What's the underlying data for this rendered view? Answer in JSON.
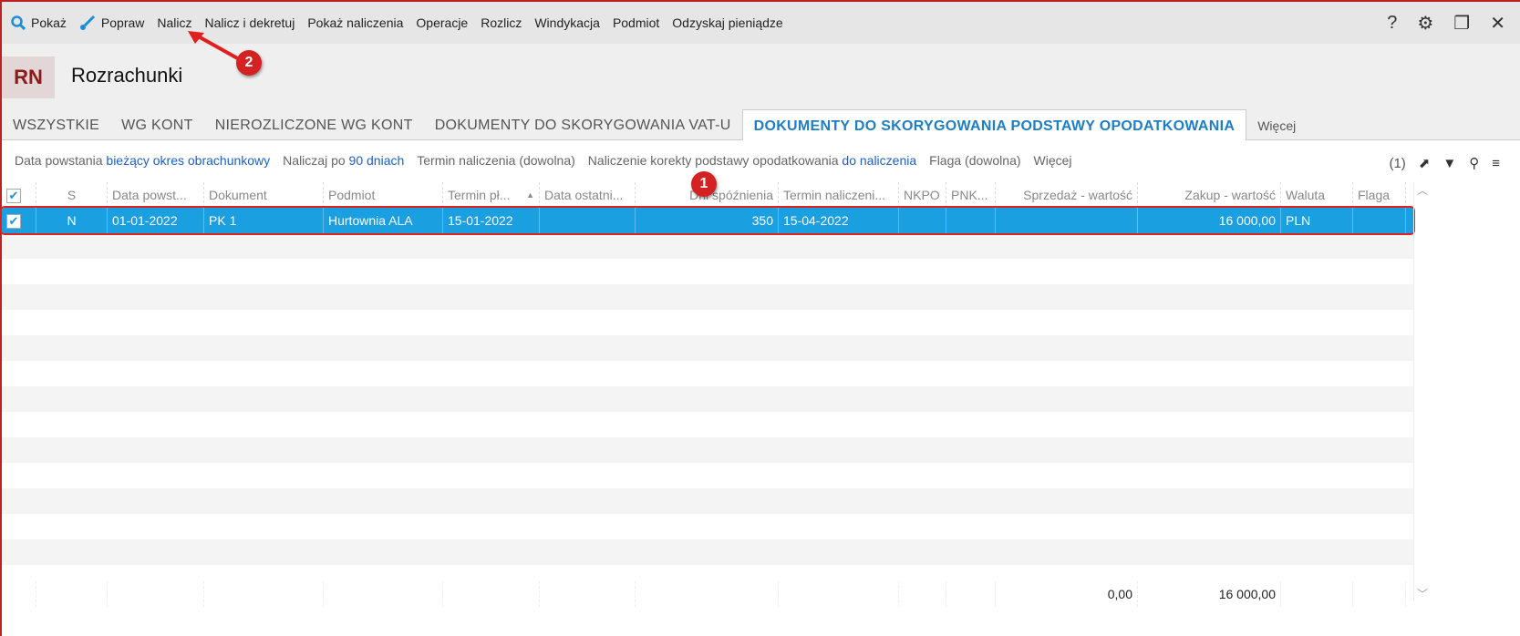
{
  "toolbar": {
    "items": [
      "Pokaż",
      "Popraw",
      "Nalicz",
      "Nalicz i dekretuj",
      "Pokaż naliczenia",
      "Operacje",
      "Rozlicz",
      "Windykacja",
      "Podmiot",
      "Odzyskaj pieniądze"
    ],
    "help": "?"
  },
  "header": {
    "badge": "RN",
    "title": "Rozrachunki"
  },
  "tabs": [
    "WSZYSTKIE",
    "WG KONT",
    "NIEROZLICZONE WG KONT",
    "DOKUMENTY DO SKORYGOWANIA VAT-U",
    "DOKUMENTY DO SKORYGOWANIA PODSTAWY OPODATKOWANIA",
    "Więcej"
  ],
  "active_tab": 4,
  "filters": {
    "f1_label": "Data powstania",
    "f1_value": "bieżący okres obrachunkowy",
    "f2_label": "Naliczaj po",
    "f2_value": "90 dniach",
    "f3": "Termin naliczenia (dowolna)",
    "f4_label": "Naliczenie korekty podstawy opodatkowania",
    "f4_value": "do naliczenia",
    "f5": "Flaga (dowolna)",
    "f6": "Więcej",
    "count": "(1)"
  },
  "grid": {
    "columns": [
      "",
      "S",
      "Data powst...",
      "Dokument",
      "Podmiot",
      "Termin pł...",
      "Data ostatni...",
      "Dni spóźnienia",
      "Termin naliczeni...",
      "NKPO",
      "PNK...",
      "Sprzedaż - wartość",
      "Zakup - wartość",
      "Waluta",
      "Flaga"
    ],
    "sorted_column": "Termin pł...",
    "rows": [
      [
        "",
        "N",
        "01-01-2022",
        "PK 1",
        "Hurtownia ALA",
        "15-01-2022",
        "",
        "350",
        "15-04-2022",
        "",
        "",
        "",
        "16 000,00",
        "PLN",
        ""
      ]
    ],
    "selected_row": 0,
    "footer": {
      "sprzedaz": "0,00",
      "zakup": "16 000,00"
    }
  },
  "annotations": {
    "a1": "1",
    "a2": "2"
  },
  "colors": {
    "accent": "#1f7ec3",
    "selection": "#1a9fe0",
    "annotation": "#d42222"
  }
}
